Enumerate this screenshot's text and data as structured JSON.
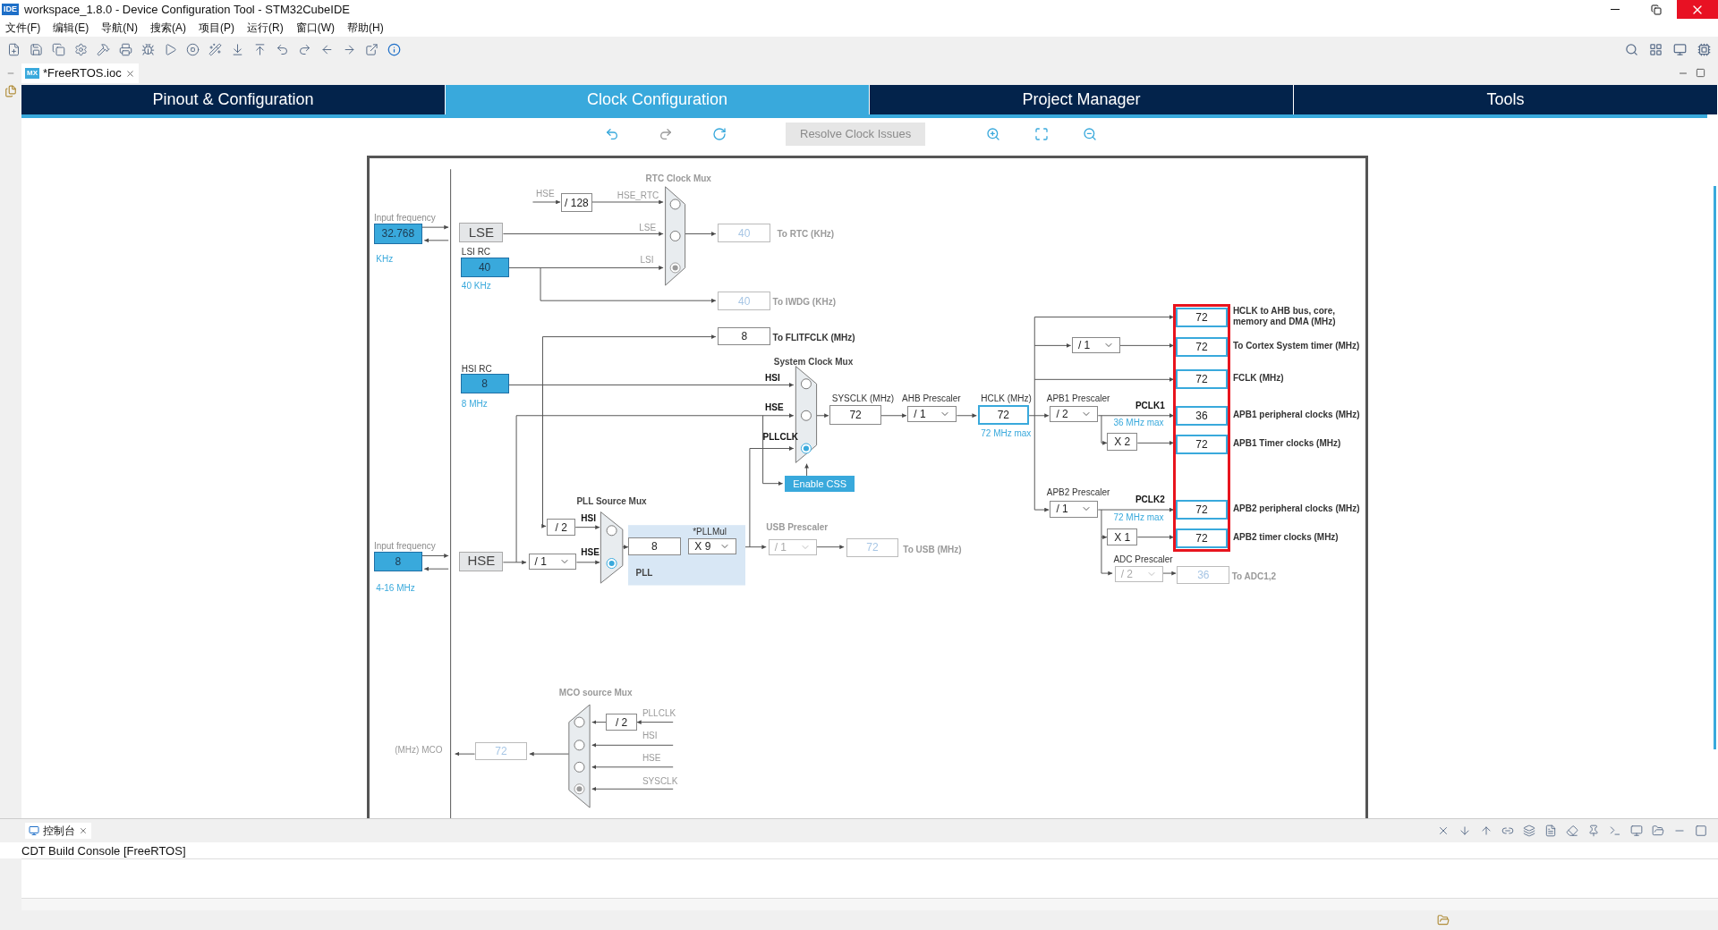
{
  "window": {
    "title": "workspace_1.8.0 - Device Configuration Tool - STM32CubeIDE",
    "icon": "IDE"
  },
  "menu": [
    "文件(F)",
    "编辑(E)",
    "导航(N)",
    "搜索(A)",
    "项目(P)",
    "运行(R)",
    "窗口(W)",
    "帮助(H)"
  ],
  "editor_tab": {
    "badge": "MX",
    "label": "*FreeRTOS.ioc"
  },
  "tabs": [
    {
      "label": "Pinout & Configuration",
      "selected": false
    },
    {
      "label": "Clock Configuration",
      "selected": true
    },
    {
      "label": "Project Manager",
      "selected": false
    },
    {
      "label": "Tools",
      "selected": false
    }
  ],
  "clock_toolbar": {
    "resolve_button": {
      "label": "Resolve Clock Issues",
      "disabled": true
    }
  },
  "diagram": {
    "items": [
      {
        "kind": "title",
        "text": "RTC Clock Mux",
        "disabled": true
      },
      {
        "kind": "signal",
        "text": "HSE",
        "disabled": true
      },
      {
        "kind": "value",
        "text": "/ 128",
        "disabled": false
      },
      {
        "kind": "signal",
        "text": "HSE_RTC",
        "disabled": true
      },
      {
        "kind": "caption",
        "text": "Input frequency",
        "disabled": true
      },
      {
        "kind": "input",
        "text": "32.768"
      },
      {
        "kind": "unit",
        "text": "KHz"
      },
      {
        "kind": "source",
        "text": "LSE"
      },
      {
        "kind": "signal",
        "text": "LSE",
        "disabled": true
      },
      {
        "kind": "value",
        "text": "40",
        "disabled": true
      },
      {
        "kind": "dest",
        "text": "To RTC (KHz)",
        "disabled": true
      },
      {
        "kind": "caption",
        "text": "LSI RC",
        "disabled": false
      },
      {
        "kind": "input",
        "text": "40"
      },
      {
        "kind": "unit",
        "text": "40 KHz"
      },
      {
        "kind": "signal",
        "text": "LSI",
        "disabled": true
      },
      {
        "kind": "value",
        "text": "40",
        "disabled": true
      },
      {
        "kind": "dest",
        "text": "To IWDG (KHz)",
        "disabled": true
      },
      {
        "kind": "value",
        "text": "8",
        "disabled": false
      },
      {
        "kind": "dest",
        "text": "To FLITFCLK (MHz)",
        "disabled": false
      },
      {
        "kind": "title",
        "text": "System Clock Mux",
        "disabled": false
      },
      {
        "kind": "caption",
        "text": "HSI RC",
        "disabled": false
      },
      {
        "kind": "input",
        "text": "8"
      },
      {
        "kind": "unit",
        "text": "8 MHz"
      },
      {
        "kind": "signal",
        "text": "HSI",
        "disabled": false
      },
      {
        "kind": "signal",
        "text": "HSE",
        "disabled": false
      },
      {
        "kind": "signal",
        "text": "PLLCLK",
        "disabled": false
      },
      {
        "kind": "caption",
        "text": "SYSCLK (MHz)",
        "disabled": false
      },
      {
        "kind": "value",
        "text": "72",
        "disabled": false
      },
      {
        "kind": "caption",
        "text": "AHB Prescaler",
        "disabled": false
      },
      {
        "kind": "dropdown",
        "text": "/ 1",
        "disabled": false
      },
      {
        "kind": "caption",
        "text": "HCLK (MHz)",
        "disabled": false
      },
      {
        "kind": "value",
        "text": "72",
        "disabled": false,
        "highlight": true
      },
      {
        "kind": "unit",
        "text": "72 MHz max"
      },
      {
        "kind": "caption",
        "text": "APB1 Prescaler",
        "disabled": false
      },
      {
        "kind": "dropdown",
        "text": "/ 2",
        "disabled": false
      },
      {
        "kind": "signal",
        "text": "PCLK1",
        "disabled": false
      },
      {
        "kind": "unit",
        "text": "36 MHz max"
      },
      {
        "kind": "value",
        "text": "X 2",
        "disabled": false
      },
      {
        "kind": "dropdown",
        "text": "/ 1",
        "disabled": false
      },
      {
        "kind": "button",
        "text": "Enable CSS"
      },
      {
        "kind": "title",
        "text": "PLL Source Mux",
        "disabled": false
      },
      {
        "kind": "value",
        "text": "/ 2",
        "disabled": false
      },
      {
        "kind": "signal",
        "text": "HSI",
        "disabled": false
      },
      {
        "kind": "signal",
        "text": "HSE",
        "disabled": false
      },
      {
        "kind": "caption",
        "text": "*PLLMul",
        "disabled": false
      },
      {
        "kind": "value",
        "text": "8",
        "disabled": false
      },
      {
        "kind": "dropdown",
        "text": "X 9",
        "disabled": false
      },
      {
        "kind": "title",
        "text": "PLL",
        "disabled": false
      },
      {
        "kind": "title",
        "text": "USB Prescaler",
        "disabled": true
      },
      {
        "kind": "dropdown",
        "text": "/ 1",
        "disabled": true
      },
      {
        "kind": "value",
        "text": "72",
        "disabled": true
      },
      {
        "kind": "dest",
        "text": "To USB (MHz)",
        "disabled": true
      },
      {
        "kind": "caption",
        "text": "Input frequency",
        "disabled": true
      },
      {
        "kind": "input",
        "text": "8"
      },
      {
        "kind": "unit",
        "text": "4-16 MHz"
      },
      {
        "kind": "source",
        "text": "HSE"
      },
      {
        "kind": "dropdown",
        "text": "/ 1",
        "disabled": false
      },
      {
        "kind": "caption",
        "text": "APB2 Prescaler",
        "disabled": false
      },
      {
        "kind": "dropdown",
        "text": "/ 1",
        "disabled": false
      },
      {
        "kind": "signal",
        "text": "PCLK2",
        "disabled": false
      },
      {
        "kind": "unit",
        "text": "72 MHz max"
      },
      {
        "kind": "value",
        "text": "X 1",
        "disabled": false
      },
      {
        "kind": "caption",
        "text": "ADC Prescaler",
        "disabled": false
      },
      {
        "kind": "dropdown",
        "text": "/ 2",
        "disabled": true
      },
      {
        "kind": "value",
        "text": "36",
        "disabled": true
      },
      {
        "kind": "dest",
        "text": "To ADC1,2",
        "disabled": true
      },
      {
        "kind": "title",
        "text": "MCO source Mux",
        "disabled": true
      },
      {
        "kind": "value",
        "text": "/ 2",
        "disabled": false
      },
      {
        "kind": "signal",
        "text": "PLLCLK",
        "disabled": true
      },
      {
        "kind": "signal",
        "text": "HSI",
        "disabled": true
      },
      {
        "kind": "signal",
        "text": "HSE",
        "disabled": true
      },
      {
        "kind": "signal",
        "text": "SYSCLK",
        "disabled": true
      },
      {
        "kind": "value",
        "text": "72",
        "disabled": true
      },
      {
        "kind": "signal",
        "text": "(MHz) MCO",
        "disabled": true
      }
    ],
    "muxes": [
      {
        "disabled": true,
        "options": [
          {
            "selected": false
          },
          {
            "selected": false
          },
          {
            "selected": true
          }
        ]
      },
      {
        "disabled": false,
        "options": [
          {
            "selected": false
          },
          {
            "selected": false
          },
          {
            "selected": true
          }
        ]
      },
      {
        "disabled": false,
        "options": [
          {
            "selected": false
          },
          {
            "selected": true
          }
        ]
      },
      {
        "disabled": true,
        "options": [
          {
            "selected": false
          },
          {
            "selected": false
          },
          {
            "selected": false
          },
          {
            "selected": true
          }
        ]
      }
    ],
    "outputs_highlighted": true,
    "outputs": [
      {
        "value": "72",
        "label": "HCLK to AHB bus, core, memory and DMA (MHz)"
      },
      {
        "value": "72",
        "label": "To Cortex System timer (MHz)"
      },
      {
        "value": "72",
        "label": "FCLK (MHz)"
      },
      {
        "value": "36",
        "label": "APB1 peripheral clocks (MHz)"
      },
      {
        "value": "72",
        "label": "APB1 Timer clocks (MHz)"
      },
      {
        "value": "72",
        "label": "APB2 peripheral clocks (MHz)"
      },
      {
        "value": "72",
        "label": "APB2 timer clocks (MHz)"
      }
    ]
  },
  "console": {
    "tab": "控制台",
    "title": "CDT Build Console [FreeRTOS]"
  }
}
